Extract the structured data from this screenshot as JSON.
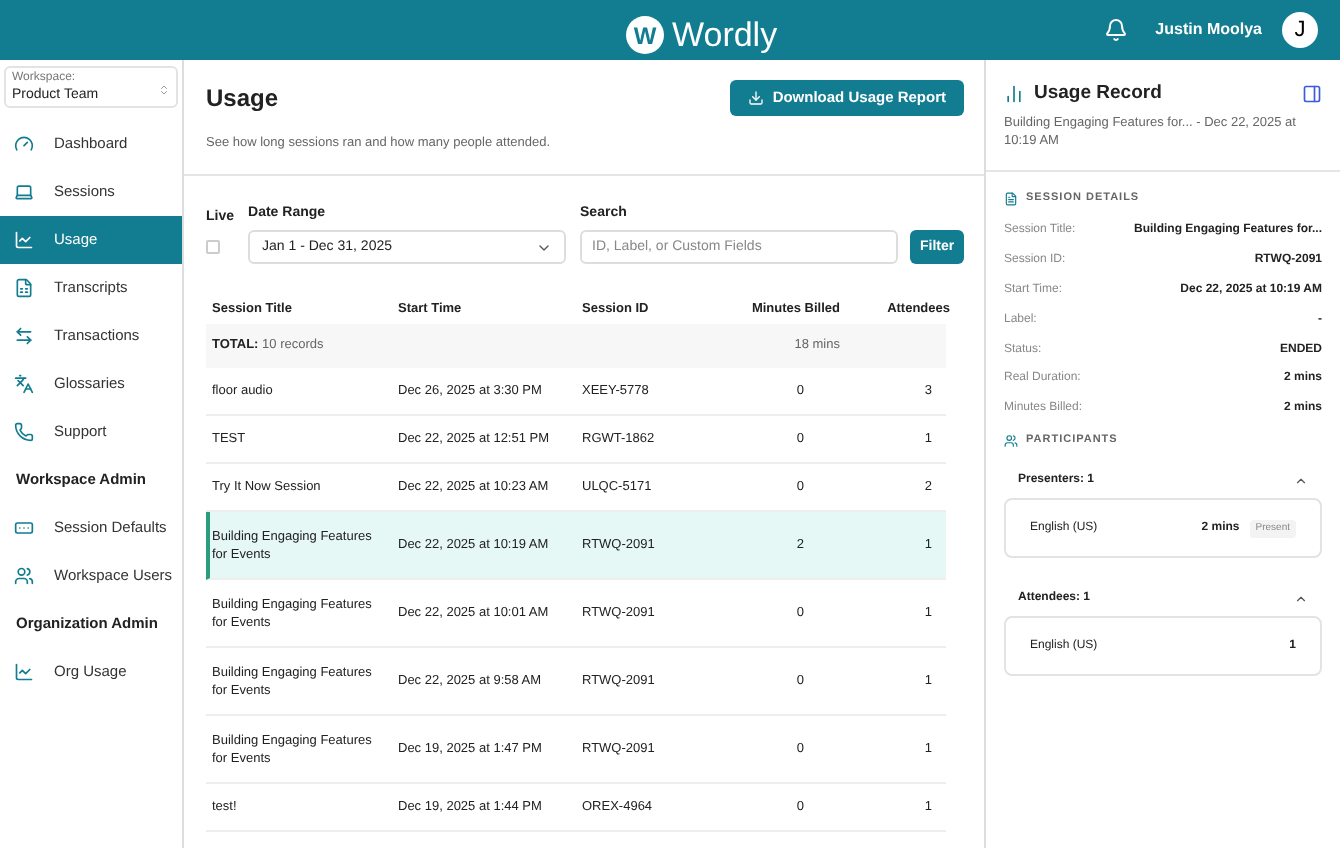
{
  "header": {
    "logo_mark": "W",
    "logo_text": "Wordly",
    "user_name": "Justin Moolya",
    "avatar_initial": "J"
  },
  "sidebar": {
    "workspace_label": "Workspace:",
    "workspace_value": "Product Team",
    "items": [
      {
        "kind": "item",
        "label": "Dashboard",
        "selected": false
      },
      {
        "kind": "item",
        "label": "Sessions",
        "selected": false
      },
      {
        "kind": "item",
        "label": "Usage",
        "selected": true
      },
      {
        "kind": "item",
        "label": "Transcripts",
        "selected": false
      },
      {
        "kind": "item",
        "label": "Transactions",
        "selected": false
      },
      {
        "kind": "item",
        "label": "Glossaries",
        "selected": false
      },
      {
        "kind": "item",
        "label": "Support",
        "selected": false
      },
      {
        "kind": "heading",
        "label": "Workspace Admin"
      },
      {
        "kind": "item",
        "label": "Session Defaults",
        "selected": false
      },
      {
        "kind": "item",
        "label": "Workspace Users",
        "selected": false
      },
      {
        "kind": "heading",
        "label": "Organization Admin"
      },
      {
        "kind": "item",
        "label": "Org Usage",
        "selected": false
      }
    ]
  },
  "main": {
    "title": "Usage",
    "download_button": "Download Usage Report",
    "subtitle": "See how long sessions ran and how many people attended.",
    "filters": {
      "live_label": "Live",
      "live_checked": false,
      "date_label": "Date Range",
      "date_value": "Jan 1 - Dec 31, 2025",
      "search_label": "Search",
      "search_placeholder": "ID, Label, or Custom Fields",
      "filter_button": "Filter"
    },
    "table": {
      "columns": [
        "Session Title",
        "Start Time",
        "Session ID",
        "Minutes Billed",
        "Attendees"
      ],
      "total": {
        "label": "TOTAL:",
        "records": "10 records",
        "minutes": "18 mins"
      },
      "rows": [
        {
          "title": "floor audio",
          "start": "Dec 26, 2025 at 3:30 PM",
          "id": "XEEY-5778",
          "minutes": "0",
          "attendees": "3",
          "selected": false
        },
        {
          "title": "TEST",
          "start": "Dec 22, 2025 at 12:51 PM",
          "id": "RGWT-1862",
          "minutes": "0",
          "attendees": "1",
          "selected": false
        },
        {
          "title": "Try It Now Session",
          "start": "Dec 22, 2025 at 10:23 AM",
          "id": "ULQC-5171",
          "minutes": "0",
          "attendees": "2",
          "selected": false
        },
        {
          "title": "Building Engaging Features for Events",
          "start": "Dec 22, 2025 at 10:19 AM",
          "id": "RTWQ-2091",
          "minutes": "2",
          "attendees": "1",
          "selected": true
        },
        {
          "title": "Building Engaging Features for Events",
          "start": "Dec 22, 2025 at 10:01 AM",
          "id": "RTWQ-2091",
          "minutes": "0",
          "attendees": "1",
          "selected": false
        },
        {
          "title": "Building Engaging Features for Events",
          "start": "Dec 22, 2025 at 9:58 AM",
          "id": "RTWQ-2091",
          "minutes": "0",
          "attendees": "1",
          "selected": false
        },
        {
          "title": "Building Engaging Features for Events",
          "start": "Dec 19, 2025 at 1:47 PM",
          "id": "RTWQ-2091",
          "minutes": "0",
          "attendees": "1",
          "selected": false
        },
        {
          "title": "test!",
          "start": "Dec 19, 2025 at 1:44 PM",
          "id": "OREX-4964",
          "minutes": "0",
          "attendees": "1",
          "selected": false
        }
      ]
    }
  },
  "record": {
    "title": "Usage Record",
    "subtitle": "Building Engaging Features for... - Dec 22, 2025 at 10:19 AM",
    "details_heading": "SESSION DETAILS",
    "details": [
      {
        "label": "Session Title:",
        "value": "Building Engaging Features for..."
      },
      {
        "label": "Session ID:",
        "value": "RTWQ-2091"
      },
      {
        "label": "Start Time:",
        "value": "Dec 22, 2025 at 10:19 AM"
      },
      {
        "label": "Label:",
        "value": "-"
      },
      {
        "label": "Status:",
        "value": "ENDED"
      },
      {
        "label": "Real Duration:",
        "value": "2 mins"
      },
      {
        "label": "Minutes Billed:",
        "value": "2 mins"
      }
    ],
    "participants_heading": "PARTICIPANTS",
    "groups": [
      {
        "title": "Presenters: 1",
        "expanded": true,
        "entries": [
          {
            "language": "English (US)",
            "value": "2 mins",
            "badge": "Present"
          }
        ]
      },
      {
        "title": "Attendees: 1",
        "expanded": true,
        "entries": [
          {
            "language": "English (US)",
            "value": "1"
          }
        ]
      }
    ]
  }
}
